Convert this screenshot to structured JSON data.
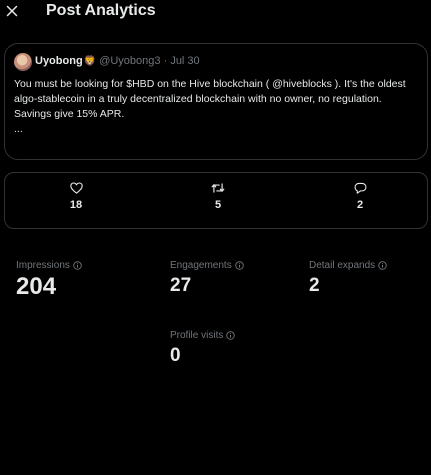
{
  "header": {
    "title": "Post Analytics",
    "close_icon": "close-icon"
  },
  "post": {
    "author_name": "Uyobong",
    "author_emoji": "🦁",
    "handle": "@Uyobong3",
    "separator": "·",
    "date": "Jul 30",
    "line1_before": "You must be looking for $HBD on the Hive blockchain (",
    "mention": "@hiveblocks",
    "line1_after": " ). It's the oldest algo-stablecoin in a truly decentralized blockchain with no owner, no regulation.",
    "line2": "Savings give 15% APR.",
    "line3": "..."
  },
  "engagement": {
    "likes": {
      "icon": "heart-icon",
      "value": "18"
    },
    "reposts": {
      "icon": "repost-icon",
      "value": "5"
    },
    "replies": {
      "icon": "reply-icon",
      "value": "2"
    }
  },
  "metrics": {
    "impressions": {
      "label": "Impressions",
      "value": "204"
    },
    "engagements": {
      "label": "Engagements",
      "value": "27"
    },
    "detail_expands": {
      "label": "Detail expands",
      "value": "2"
    },
    "profile_visits": {
      "label": "Profile visits",
      "value": "0"
    }
  },
  "colors": {
    "background": "#000000",
    "text": "#e7e9ea",
    "muted": "#71767b",
    "border": "#2f3336"
  }
}
